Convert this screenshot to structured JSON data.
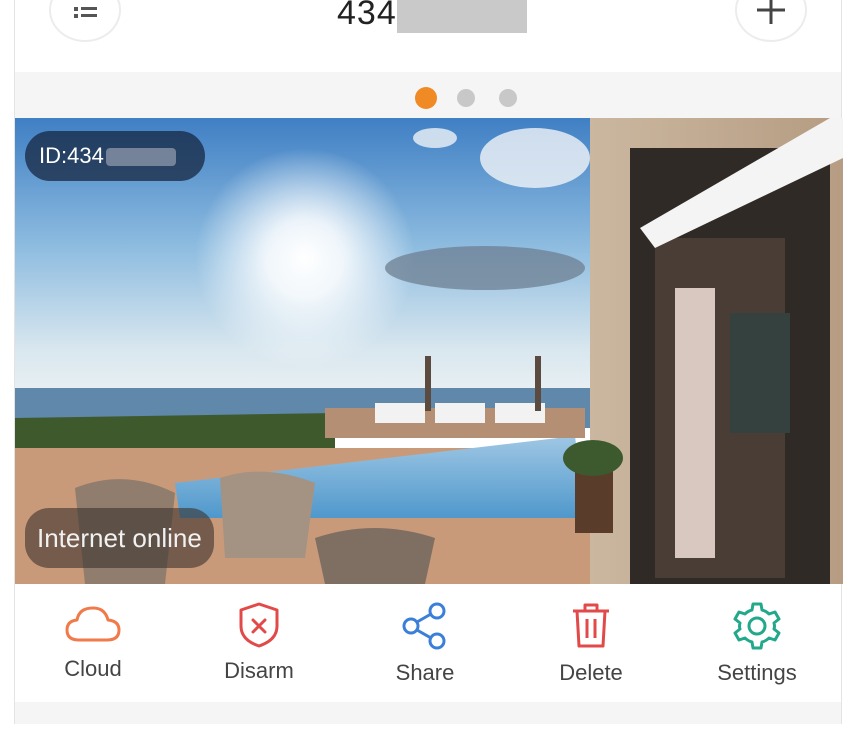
{
  "header": {
    "title": "434",
    "menu_icon": "menu-list-icon",
    "add_icon": "plus-icon"
  },
  "carousel": {
    "active_index": 0,
    "count": 3,
    "active_color": "#f08a24",
    "inactive_color": "#c8c8c8"
  },
  "camera": {
    "id_label": "ID:434",
    "status": "Internet online"
  },
  "actions": [
    {
      "label": "Cloud",
      "icon": "cloud-icon",
      "color": "#f07a4a"
    },
    {
      "label": "Disarm",
      "icon": "shield-x-icon",
      "color": "#e24a4a"
    },
    {
      "label": "Share",
      "icon": "share-icon",
      "color": "#3b7fd8"
    },
    {
      "label": "Delete",
      "icon": "trash-icon",
      "color": "#e24a4a"
    },
    {
      "label": "Settings",
      "icon": "gear-icon",
      "color": "#22a88a"
    }
  ]
}
